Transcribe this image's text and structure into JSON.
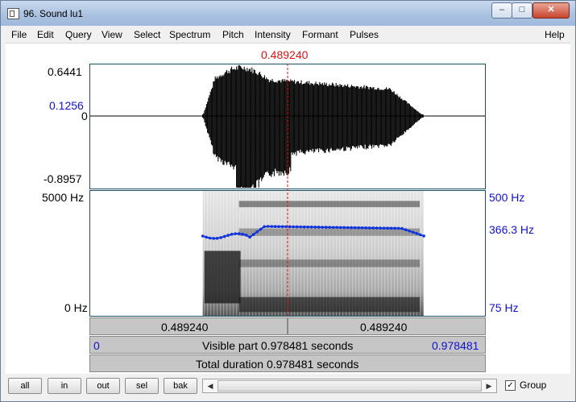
{
  "window": {
    "title": "96. Sound lu1",
    "controls": {
      "minimize": "–",
      "maximize": "□",
      "close": "✕"
    }
  },
  "menu": [
    "File",
    "Edit",
    "Query",
    "View",
    "Select",
    "Spectrum",
    "Pitch",
    "Intensity",
    "Formant",
    "Pulses",
    "Help"
  ],
  "cursor": {
    "time_label": "0.489240",
    "time_fraction": 0.5
  },
  "waveform": {
    "y_max": "0.6441",
    "y_cursor_value": "0.1256",
    "y_zero": "0",
    "y_min": "-0.8957"
  },
  "spectrogram": {
    "freq_max": "5000 Hz",
    "freq_min": "0 Hz",
    "pitch_max": "500 Hz",
    "pitch_current": "366.3 Hz",
    "pitch_min": "75 Hz",
    "sound_start_fraction": 0.285,
    "sound_end_fraction": 0.845
  },
  "time_panels": {
    "left_label": "0.489240",
    "right_label": "0.489240",
    "visible_start": "0",
    "visible_text": "Visible part 0.978481 seconds",
    "visible_end": "0.978481",
    "total_text": "Total duration 0.978481 seconds"
  },
  "bottom_buttons": [
    "all",
    "in",
    "out",
    "sel",
    "bak"
  ],
  "scroll": {
    "left_arrow": "◀",
    "right_arrow": "▶"
  },
  "group": {
    "checked": true,
    "check_mark": "✓",
    "label": "Group"
  },
  "colors": {
    "cursor": "#dd1111",
    "pitch": "#1133dd",
    "axis_blue": "#1111cc",
    "frame": "#1a5066"
  }
}
